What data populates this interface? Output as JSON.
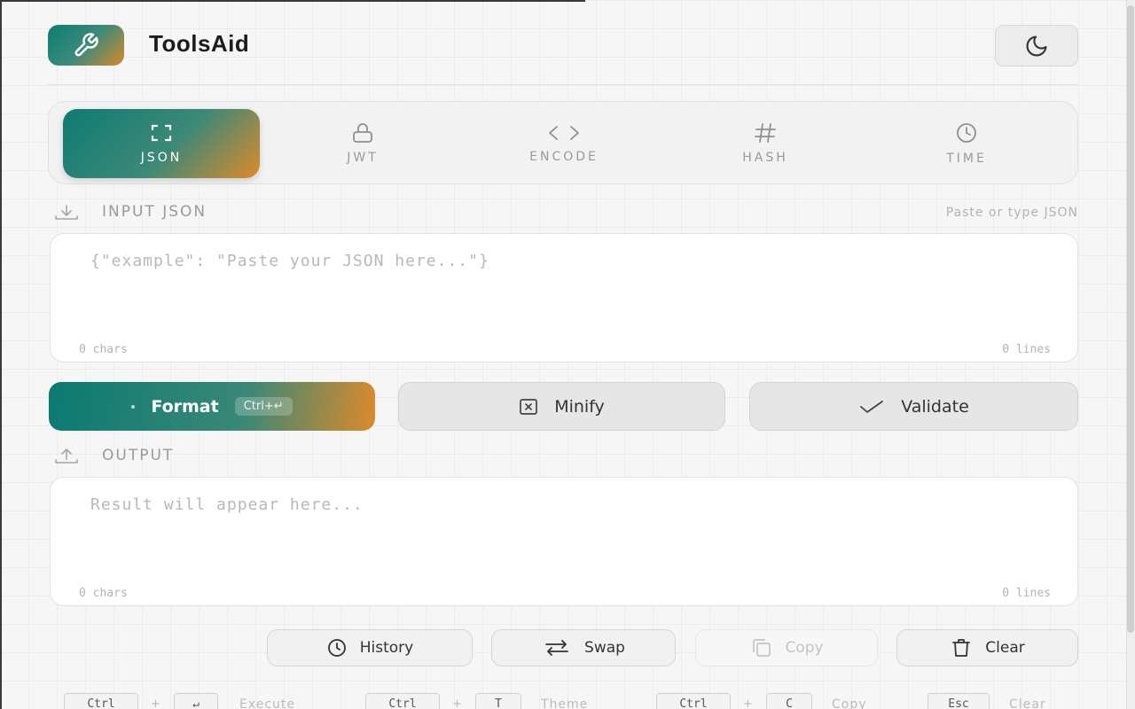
{
  "app": {
    "brand": "ToolsAid"
  },
  "tabs": [
    {
      "label": "JSON",
      "icon": "braces-frame-icon",
      "active": true
    },
    {
      "label": "JWT",
      "icon": "lock-icon",
      "active": false
    },
    {
      "label": "ENCODE",
      "icon": "code-icon",
      "active": false
    },
    {
      "label": "HASH",
      "icon": "hash-icon",
      "active": false
    },
    {
      "label": "TIME",
      "icon": "clock-icon",
      "active": false
    }
  ],
  "input": {
    "title": "INPUT JSON",
    "hint": "Paste or type JSON",
    "placeholder": "{\"example\": \"Paste your JSON here...\"}",
    "chars": "0 chars",
    "lines": "0 lines"
  },
  "actions": {
    "format": "Format",
    "format_shortcut": "Ctrl+↵",
    "minify": "Minify",
    "validate": "Validate"
  },
  "output": {
    "title": "OUTPUT",
    "placeholder": "Result will appear here...",
    "chars": "0 chars",
    "lines": "0 lines"
  },
  "toolbar": {
    "history": "History",
    "swap": "Swap",
    "copy": "Copy",
    "clear": "Clear"
  },
  "shortcuts": [
    {
      "mod": "Ctrl",
      "key": "↵",
      "label": "Execute"
    },
    {
      "mod": "Ctrl",
      "key": "T",
      "label": "Theme"
    },
    {
      "mod": "Ctrl",
      "key": "C",
      "label": "Copy"
    },
    {
      "key": "Esc",
      "label": "Clear"
    }
  ],
  "colors": {
    "accent_start": "#0e7b72",
    "accent_end": "#de8a2a"
  }
}
